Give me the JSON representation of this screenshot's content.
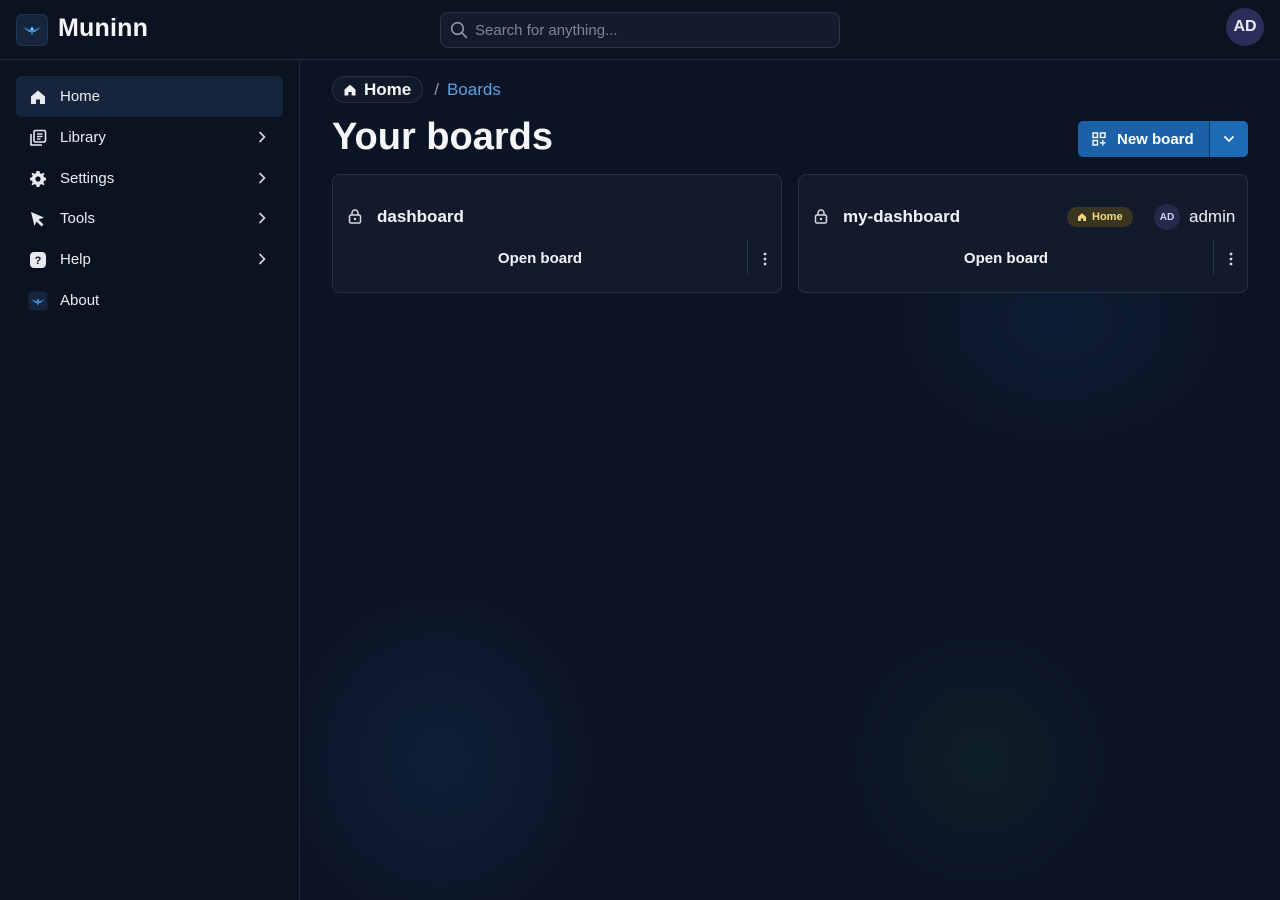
{
  "app": {
    "title": "Muninn",
    "user_initials": "AD"
  },
  "search": {
    "placeholder": "Search for anything..."
  },
  "sidebar": {
    "items": [
      {
        "label": "Home",
        "icon": "home-icon",
        "active": true,
        "has_chevron": false
      },
      {
        "label": "Library",
        "icon": "library-icon",
        "active": false,
        "has_chevron": true
      },
      {
        "label": "Settings",
        "icon": "gear-icon",
        "active": false,
        "has_chevron": true
      },
      {
        "label": "Tools",
        "icon": "pointer-icon",
        "active": false,
        "has_chevron": true
      },
      {
        "label": "Help",
        "icon": "help-icon",
        "active": false,
        "has_chevron": true
      },
      {
        "label": "About",
        "icon": "logo-icon",
        "active": false,
        "has_chevron": false
      }
    ]
  },
  "breadcrumb": {
    "home": "Home",
    "separator": "/",
    "current": "Boards"
  },
  "main": {
    "title": "Your boards",
    "new_board_label": "New board"
  },
  "boards": [
    {
      "name": "dashboard",
      "open_label": "Open board",
      "badge": null,
      "owner_initials": null,
      "owner_name": null
    },
    {
      "name": "my-dashboard",
      "open_label": "Open board",
      "badge": "Home",
      "owner_initials": "AD",
      "owner_name": "admin"
    }
  ],
  "colors": {
    "accent": "#1a61a8",
    "link": "#5aa2e6",
    "background": "#0b1220",
    "badge_text": "#f0d97a"
  }
}
